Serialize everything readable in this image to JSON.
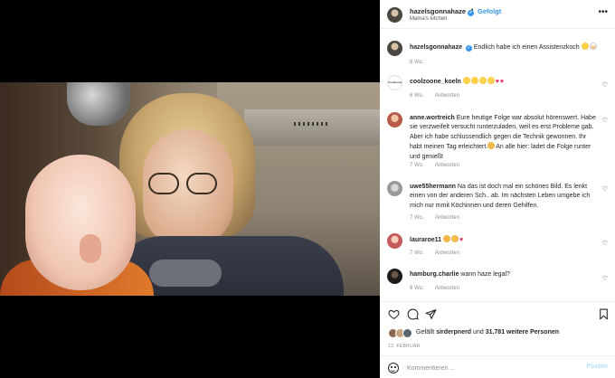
{
  "post": {
    "username": "hazelsgonnahaze",
    "follow_status": "Gefolgt",
    "separator": "•",
    "location": "Mama's kitchen",
    "more_icon": "more-dots-icon"
  },
  "caption": {
    "username": "hazelsgonnahaze",
    "text": "Endlich habe ich einen Assistenzkoch",
    "time": "8 Wo."
  },
  "comments": [
    {
      "username": "coolzoone_koeln",
      "avatar_text": "Coolzoone",
      "text": "",
      "time": "6 Wo.",
      "reply": "Antworten"
    },
    {
      "username": "anne.wortreich",
      "text": "Eure heutige Folge war absolut hörenswert. Habe sie verzweifelt versucht runterzuladen, weil es erst Probleme gab. Aber ich habe schlussendlich gegen die Technik gewonnen. Ihr habt meinen Tag erleichtert.",
      "text2": "An alle hier: ladet die Folge runter und genießt",
      "time": "7 Wo.",
      "reply": "Antworten"
    },
    {
      "username": "uwe55hermann",
      "text": "Na das ist doch mal ein schönes Bild. Es lenkt einen von der anderen Sch.. ab. Im nächsten Leben umgebe ich mich nur mmit Köchinnen und deren Gehilfen.",
      "time": "7 Wo.",
      "reply": "Antworten"
    },
    {
      "username": "lauraroe11",
      "text": "",
      "time": "7 Wo.",
      "reply": "Antworten"
    },
    {
      "username": "hamburg.charlie",
      "text": "wann haze legal?",
      "time": "8 Wo.",
      "reply": "Antworten"
    }
  ],
  "likes": {
    "prefix": "Gefällt",
    "user": "sirderpnerd",
    "middle": "und",
    "count": "31.781 weitere Personen"
  },
  "date": "13. FEBRUAR",
  "add_comment": {
    "placeholder": "Kommentieren ...",
    "post_label": "Posten"
  },
  "colors": {
    "link_blue": "#3897f0",
    "post_disabled": "#b2dffc",
    "muted": "#8e8e8e"
  }
}
